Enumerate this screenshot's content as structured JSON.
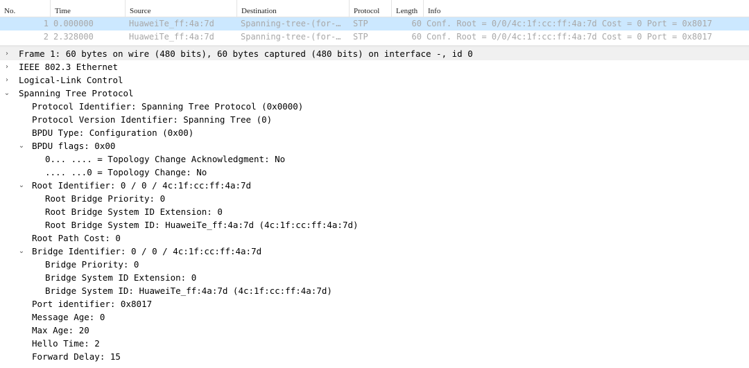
{
  "packet_list": {
    "columns": [
      "No.",
      "Time",
      "Source",
      "Destination",
      "Protocol",
      "Length",
      "Info"
    ],
    "rows": [
      {
        "no": "1",
        "time": "0.000000",
        "source": "HuaweiTe_ff:4a:7d",
        "destination": "Spanning-tree-(for-…",
        "protocol": "STP",
        "length": "60",
        "info": "Conf. Root = 0/0/4c:1f:cc:ff:4a:7d  Cost = 0  Port = 0x8017"
      },
      {
        "no": "2",
        "time": "2.328000",
        "source": "HuaweiTe_ff:4a:7d",
        "destination": "Spanning-tree-(for-…",
        "protocol": "STP",
        "length": "60",
        "info": "Conf. Root = 0/0/4c:1f:cc:ff:4a:7d  Cost = 0  Port = 0x8017"
      }
    ]
  },
  "details": {
    "frame": "Frame 1: 60 bytes on wire (480 bits), 60 bytes captured (480 bits) on interface -, id 0",
    "ethernet": "IEEE 802.3 Ethernet",
    "llc": "Logical-Link Control",
    "stp": "Spanning Tree Protocol",
    "protocol_identifier": "Protocol Identifier: Spanning Tree Protocol (0x0000)",
    "protocol_version": "Protocol Version Identifier: Spanning Tree (0)",
    "bpdu_type": "BPDU Type: Configuration (0x00)",
    "bpdu_flags": "BPDU flags: 0x00",
    "flag_tca": "0... .... = Topology Change Acknowledgment: No",
    "flag_tc": ".... ...0 = Topology Change: No",
    "root_identifier": "Root Identifier: 0 / 0 / 4c:1f:cc:ff:4a:7d",
    "root_bridge_priority": "Root Bridge Priority: 0",
    "root_bridge_sysid_ext": "Root Bridge System ID Extension: 0",
    "root_bridge_sysid": "Root Bridge System ID: HuaweiTe_ff:4a:7d (4c:1f:cc:ff:4a:7d)",
    "root_path_cost": "Root Path Cost: 0",
    "bridge_identifier": "Bridge Identifier: 0 / 0 / 4c:1f:cc:ff:4a:7d",
    "bridge_priority": "Bridge Priority: 0",
    "bridge_sysid_ext": "Bridge System ID Extension: 0",
    "bridge_sysid": "Bridge System ID: HuaweiTe_ff:4a:7d (4c:1f:cc:ff:4a:7d)",
    "port_identifier": "Port identifier: 0x8017",
    "message_age": "Message Age: 0",
    "max_age": "Max Age: 20",
    "hello_time": "Hello Time: 2",
    "forward_delay": "Forward Delay: 15"
  },
  "icons": {
    "collapsed": "›",
    "expanded": "⌄"
  }
}
